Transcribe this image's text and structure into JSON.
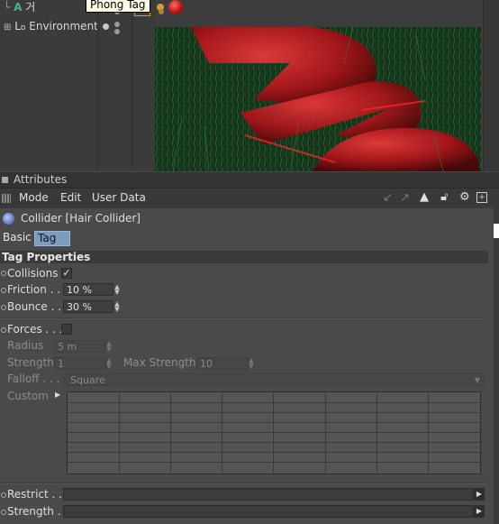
{
  "tooltip": "Phong Tag",
  "object_manager": {
    "items": [
      {
        "label": "거"
      },
      {
        "label": "Environment"
      }
    ]
  },
  "attributes": {
    "header": "Attributes",
    "menu": [
      "Mode",
      "Edit",
      "User Data"
    ],
    "object_title": "Collider [Hair Collider]",
    "tabs": [
      "Basic",
      "Tag"
    ],
    "active_tab": "Tag",
    "section_title": "Tag Properties",
    "collisions": {
      "label": "Collisions",
      "checked": true,
      "mark": "✓"
    },
    "friction": {
      "label": "Friction",
      "dots": ". . .",
      "value": "10 %"
    },
    "bounce": {
      "label": "Bounce",
      "dots": ". .",
      "value": "30 %"
    },
    "forces": {
      "label": "Forces",
      "dots": ". . .",
      "checked": false
    },
    "radius": {
      "label": "Radius",
      "value": "5 m"
    },
    "strength": {
      "label": "Strength",
      "value": "1"
    },
    "max_strength": {
      "label": "Max Strength",
      "value": "10"
    },
    "falloff": {
      "label": "Falloff",
      "dots": ". . . .",
      "value": "Square"
    },
    "custom": {
      "label": "Custom"
    },
    "restrict": {
      "label": "Restrict",
      "dots": ". ."
    },
    "strength2": {
      "label": "Strength",
      "dots": ". ."
    }
  },
  "colors": {
    "active_tab_bg": "#7b9bbf",
    "viewport_red": "#b0151a"
  }
}
